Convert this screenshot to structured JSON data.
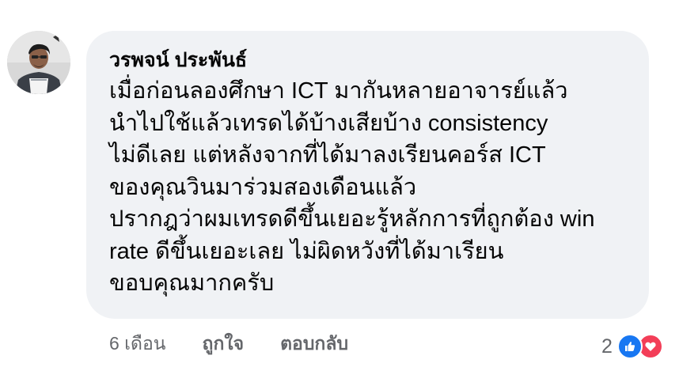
{
  "comment": {
    "author": "วรพจน์ ประพันธ์",
    "text_lines": [
      "เมื่อก่อนลองศึกษา ICT มากันหลายอาจารย์แล้ว",
      "นำไปใช้แล้วเทรดได้บ้างเสียบ้าง consistency",
      "ไม่ดีเลย แต่หลังจากที่ได้มาลงเรียนคอร์ส ICT",
      "ของคุณวินมาร่วมสองเดือนแล้ว",
      "ปรากฎว่าผมเทรดดีขึ้นเยอะรู้หลักการที่ถูกต้อง win",
      "rate ดีขึ้นเยอะเลย ไม่ผิดหวังที่ได้มาเรียน",
      "ขอบคุณมากครับ"
    ],
    "timestamp": "6 เดือน",
    "like_label": "ถูกใจ",
    "reply_label": "ตอบกลับ",
    "reaction_count": "2",
    "reactions": [
      "like-icon",
      "love-icon"
    ]
  },
  "colors": {
    "bubble_bg": "#f0f2f5",
    "text": "#050505",
    "secondary_text": "#65676b",
    "like_blue": "#1877f2",
    "love_red": "#f33e58"
  }
}
